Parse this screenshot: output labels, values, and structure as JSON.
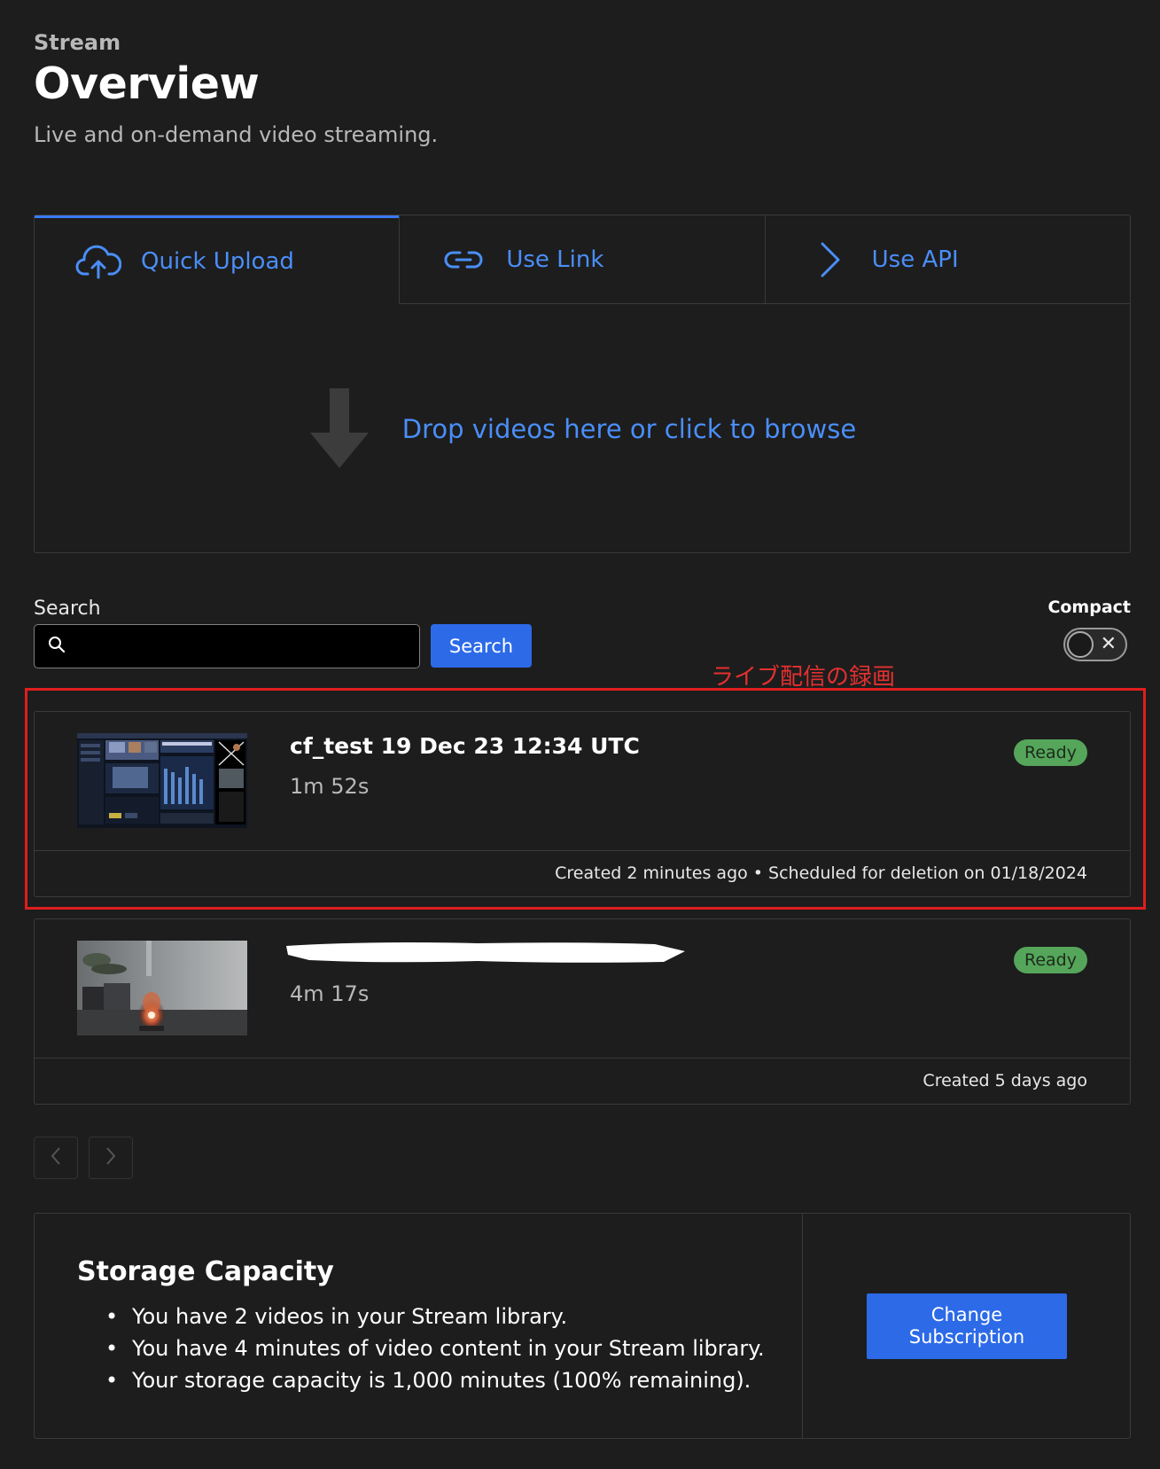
{
  "header": {
    "crumb": "Stream",
    "title": "Overview",
    "subtitle": "Live and on-demand video streaming."
  },
  "upload": {
    "tabs": [
      {
        "label": "Quick Upload",
        "icon": "cloud-upload-icon",
        "active": true
      },
      {
        "label": "Use Link",
        "icon": "link-icon",
        "active": false
      },
      {
        "label": "Use API",
        "icon": "chevron-right-icon",
        "active": false
      }
    ],
    "dropzone_text": "Drop videos here or click to browse"
  },
  "search": {
    "label": "Search",
    "value": "",
    "button_label": "Search"
  },
  "compact": {
    "label": "Compact",
    "enabled": false
  },
  "annotation": {
    "text": "ライブ配信の録画",
    "color": "#e01e1e"
  },
  "videos": [
    {
      "title": "cf_test 19 Dec 23 12:34 UTC",
      "duration": "1m 52s",
      "status": "Ready",
      "footer": "Created 2 minutes ago • Scheduled for deletion on 01/18/2024"
    },
    {
      "title": "",
      "duration": "4m 17s",
      "status": "Ready",
      "footer": "Created 5 days ago"
    }
  ],
  "storage": {
    "title": "Storage Capacity",
    "items": [
      "You have 2 videos in your Stream library.",
      "You have 4 minutes of video content in your Stream library.",
      "Your storage capacity is 1,000 minutes (100% remaining)."
    ],
    "button_label": "Change Subscription"
  },
  "colors": {
    "background": "#1d1d1d",
    "accent": "#4a8ef8",
    "button": "#2c6ae8",
    "ready_badge": "#55a65a"
  }
}
